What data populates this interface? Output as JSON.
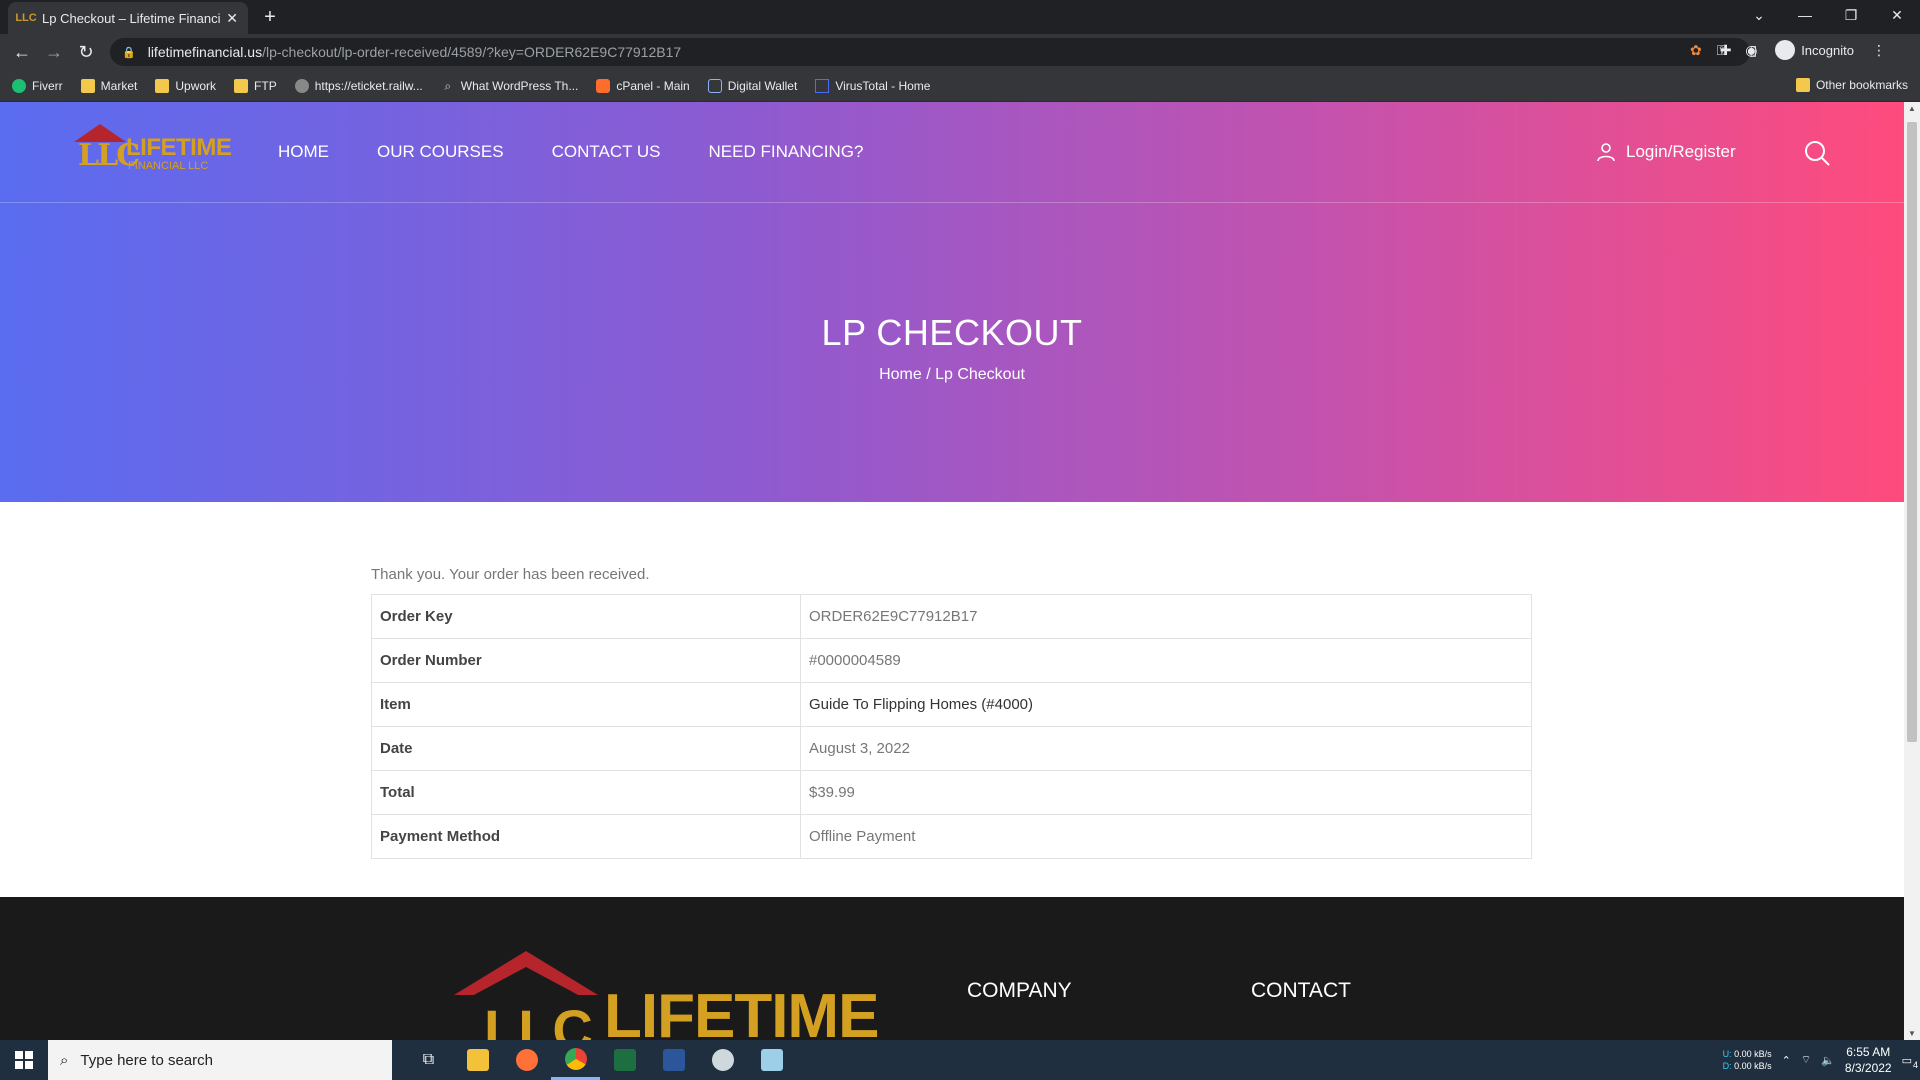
{
  "browser": {
    "tab_title": "Lp Checkout – Lifetime Financial",
    "tab_favicon": "LLC",
    "url_host": "lifetimefinancial.us",
    "url_path": "/lp-checkout/lp-order-received/4589/?key=ORDER62E9C77912B17",
    "incognito_label": "Incognito",
    "bookmarks": [
      "Fiverr",
      "Market",
      "Upwork",
      "FTP",
      "https://eticket.railw...",
      "What WordPress Th...",
      "cPanel - Main",
      "Digital Wallet",
      "VirusTotal - Home"
    ],
    "other_bookmarks": "Other bookmarks"
  },
  "site": {
    "logo_llc": "LLC",
    "logo_title": "LIFETIME",
    "logo_sub": "FINANCIAL LLC",
    "nav": [
      "HOME",
      "OUR COURSES",
      "CONTACT US",
      "NEED FINANCING?"
    ],
    "login": "Login/Register",
    "page_title": "LP CHECKOUT",
    "breadcrumb": "Home / Lp Checkout",
    "thanks": "Thank you. Your order has been received.",
    "order": [
      {
        "label": "Order Key",
        "value": "ORDER62E9C77912B17"
      },
      {
        "label": "Order Number",
        "value": "#0000004589"
      },
      {
        "label": "Item",
        "value": "Guide To Flipping Homes (#4000)"
      },
      {
        "label": "Date",
        "value": "August 3, 2022"
      },
      {
        "label": "Total",
        "value": "$39.99"
      },
      {
        "label": "Payment Method",
        "value": "Offline Payment"
      }
    ],
    "footer_logo": "LIFETIME",
    "footer_logo_llc": "LLC",
    "footer_company": "COMPANY",
    "footer_contact": "CONTACT"
  },
  "taskbar": {
    "search_placeholder": "Type here to search",
    "net_up_label": "U:",
    "net_down_label": "D:",
    "net_up": "0.00 kB/s",
    "net_down": "0.00 kB/s",
    "time": "6:55 AM",
    "date": "8/3/2022",
    "notifications": "4"
  },
  "colors": {
    "hero_start": "#5a6cf0",
    "hero_end": "#ff4b7d",
    "brand_gold": "#d4a021",
    "brand_red": "#b5252b"
  }
}
